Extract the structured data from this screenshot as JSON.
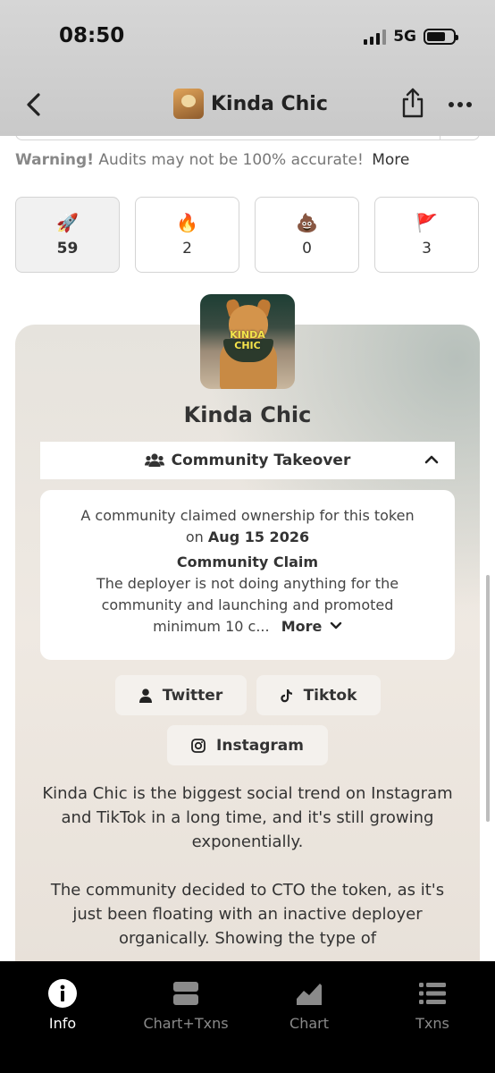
{
  "status_bar": {
    "time": "08:50",
    "network": "5G"
  },
  "nav": {
    "title": "Kinda Chic"
  },
  "warning": {
    "prefix": "Warning!",
    "text": "Audits may not be 100% accurate!",
    "more": "More"
  },
  "stats": [
    {
      "icon": "rocket-icon",
      "emoji": "🚀",
      "value": "59",
      "active": true
    },
    {
      "icon": "fire-icon",
      "emoji": "🔥",
      "value": "2",
      "active": false
    },
    {
      "icon": "poop-icon",
      "emoji": "💩",
      "value": "0",
      "active": false
    },
    {
      "icon": "flag-icon",
      "emoji": "🚩",
      "value": "3",
      "active": false
    }
  ],
  "token": {
    "image_text_1": "KINDA",
    "image_text_2": "CHIC",
    "name": "Kinda Chic"
  },
  "community": {
    "header": "Community Takeover",
    "claim_line1": "A community claimed ownership for this token",
    "claim_on": "on",
    "claim_date": "Aug 15 2026",
    "claim_title": "Community Claim",
    "desc_line1": "The deployer is not doing anything for the",
    "desc_line2": "community and launching and promoted",
    "desc_line3": "minimum 10 c...",
    "more": "More"
  },
  "socials": {
    "twitter": "Twitter",
    "tiktok": "Tiktok",
    "instagram": "Instagram"
  },
  "description": {
    "p1": "Kinda Chic is the biggest social trend on Instagram and TikTok in a long time, and it's still growing exponentially.",
    "p2": "The community decided to CTO the token, as it's just been floating with an inactive deployer organically. Showing the type of"
  },
  "tabs": {
    "info": "Info",
    "chart_txns": "Chart+Txns",
    "chart": "Chart",
    "txns": "Txns"
  },
  "colors": {
    "tab_bg": "#000000",
    "card_bg": "#ece6df",
    "active_tab": "#ffffff",
    "inactive_tab": "#8a8a8a"
  }
}
